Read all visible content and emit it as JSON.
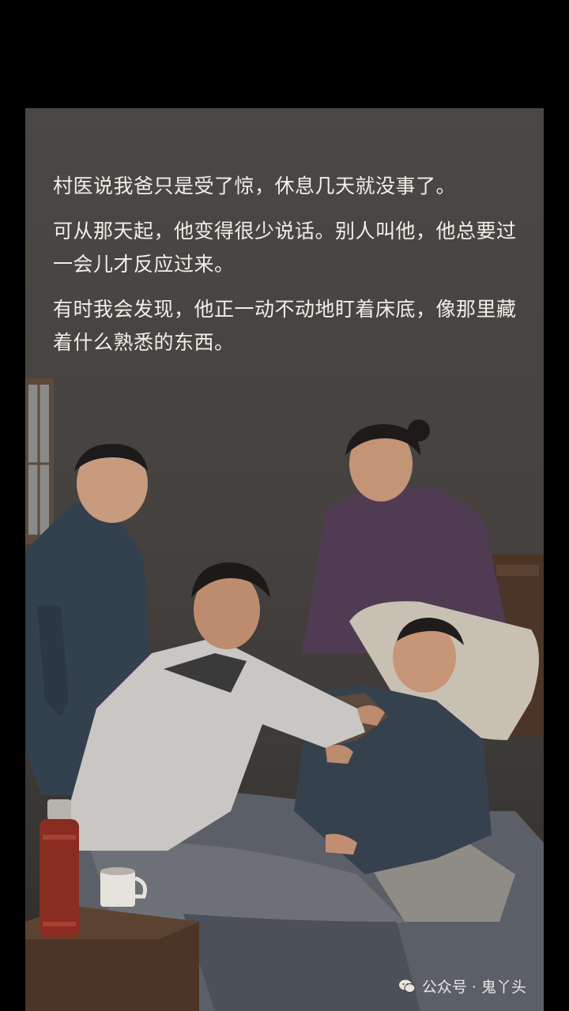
{
  "caption": {
    "line1": "村医说我爸只是受了惊，休息几天就没事了。",
    "line2": "可从那天起，他变得很少说话。别人叫他，他总要过一会儿才反应过来。",
    "line3": "有时我会发现，他正一动不动地盯着床底，像那里藏着什么熟悉的东西。"
  },
  "watermark": {
    "icon": "wechat-icon",
    "text": "公众号 · 鬼丫头"
  }
}
